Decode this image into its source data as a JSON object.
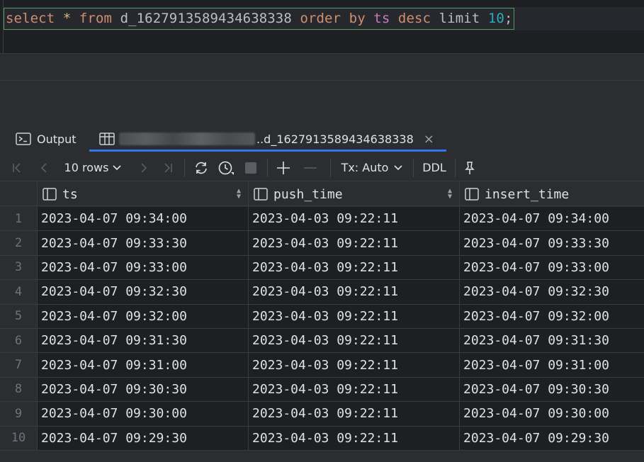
{
  "editor": {
    "tokens": [
      {
        "text": "select",
        "cls": "kw"
      },
      {
        "text": " ",
        "cls": "plain"
      },
      {
        "text": "*",
        "cls": "op"
      },
      {
        "text": " ",
        "cls": "plain"
      },
      {
        "text": "from",
        "cls": "kw"
      },
      {
        "text": " d_1627913589434638338 ",
        "cls": "plain"
      },
      {
        "text": "order by",
        "cls": "kw"
      },
      {
        "text": " ",
        "cls": "plain"
      },
      {
        "text": "ts",
        "cls": "col"
      },
      {
        "text": " ",
        "cls": "plain"
      },
      {
        "text": "desc",
        "cls": "kw"
      },
      {
        "text": " limit ",
        "cls": "plain"
      },
      {
        "text": "10",
        "cls": "num"
      },
      {
        "text": ";",
        "cls": "plain"
      }
    ]
  },
  "tabs": {
    "output_label": "Output",
    "result_label": "..d_1627913589434638338",
    "close_glyph": "×"
  },
  "toolbar": {
    "rows_label": "10 rows",
    "tx_label": "Tx: Auto",
    "ddl_label": "DDL"
  },
  "grid": {
    "columns": [
      "ts",
      "push_time",
      "insert_time"
    ],
    "rows": [
      [
        "2023-04-07 09:34:00",
        "2023-04-03 09:22:11",
        "2023-04-07 09:34:00"
      ],
      [
        "2023-04-07 09:33:30",
        "2023-04-03 09:22:11",
        "2023-04-07 09:33:30"
      ],
      [
        "2023-04-07 09:33:00",
        "2023-04-03 09:22:11",
        "2023-04-07 09:33:00"
      ],
      [
        "2023-04-07 09:32:30",
        "2023-04-03 09:22:11",
        "2023-04-07 09:32:30"
      ],
      [
        "2023-04-07 09:32:00",
        "2023-04-03 09:22:11",
        "2023-04-07 09:32:00"
      ],
      [
        "2023-04-07 09:31:30",
        "2023-04-03 09:22:11",
        "2023-04-07 09:31:30"
      ],
      [
        "2023-04-07 09:31:00",
        "2023-04-03 09:22:11",
        "2023-04-07 09:31:00"
      ],
      [
        "2023-04-07 09:30:30",
        "2023-04-03 09:22:11",
        "2023-04-07 09:30:30"
      ],
      [
        "2023-04-07 09:30:00",
        "2023-04-03 09:22:11",
        "2023-04-07 09:30:00"
      ],
      [
        "2023-04-07 09:29:30",
        "2023-04-03 09:22:11",
        "2023-04-07 09:29:30"
      ]
    ]
  }
}
